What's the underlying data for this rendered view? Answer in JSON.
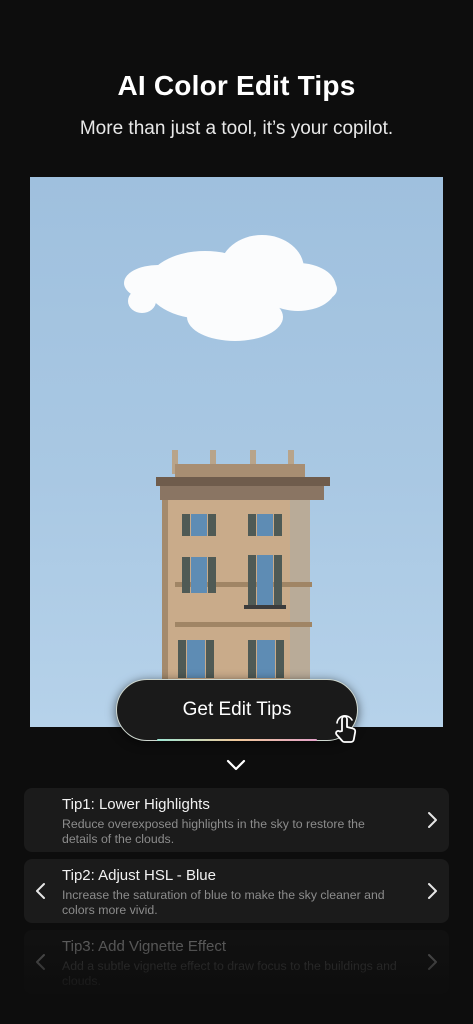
{
  "header": {
    "title": "AI Color Edit Tips",
    "subtitle": "More than just a tool, it’s your copilot."
  },
  "cta": {
    "label": "Get Edit Tips"
  },
  "tips": [
    {
      "title": "Tip1: Lower Highlights",
      "description": "Reduce overexposed highlights in the sky to restore the details of the clouds."
    },
    {
      "title": "Tip2: Adjust HSL - Blue",
      "description": "Increase the saturation of blue to make the sky cleaner and colors more vivid."
    },
    {
      "title": "Tip3: Add Vignette Effect",
      "description": "Add a subtle vignette effect to draw focus to the buildings and clouds."
    }
  ],
  "icons": {
    "cta_hand": "hand-pointer-icon",
    "expand": "chevron-down-icon",
    "prev": "chevron-left-icon",
    "next": "chevron-right-icon"
  },
  "colors": {
    "background": "#0d0d0d",
    "sky": "#a9c8e3",
    "card": "#1b1b1b"
  }
}
